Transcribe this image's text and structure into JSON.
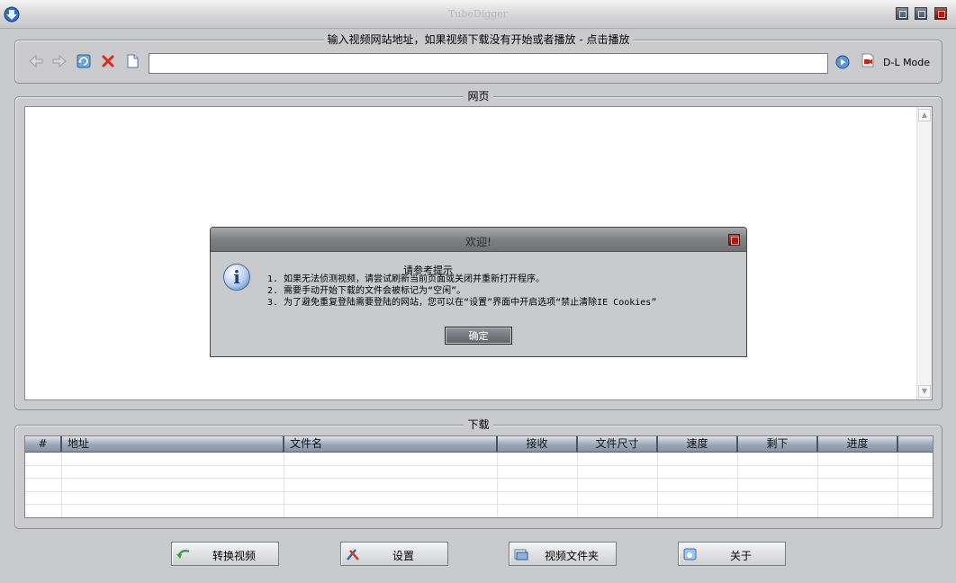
{
  "window": {
    "title": "TubeDigger"
  },
  "url_bar": {
    "caption": "输入视频网站地址，如果视频下载没有开始或者播放 - 点击播放",
    "url_value": "",
    "dl_mode_label": "D-L Mode",
    "icons": [
      "back-icon",
      "forward-icon",
      "refresh-icon",
      "stop-icon",
      "page-icon",
      "play-icon",
      "record-icon"
    ]
  },
  "webpage": {
    "caption": "网页"
  },
  "dialog": {
    "title": "欢迎!",
    "heading": "请参考提示",
    "lines": [
      "1. 如果无法侦测视频，请尝试刷新当前页面或关闭并重新打开程序。",
      "2. 需要手动开始下载的文件会被标记为“空闲”。",
      "3. 为了避免重复登陆需要登陆的网站，您可以在“设置”界面中开启选项“禁止清除IE Cookies”"
    ],
    "ok_label": "确定"
  },
  "downloads": {
    "caption": "下载",
    "columns": [
      "#",
      "地址",
      "文件名",
      "接收",
      "文件尺寸",
      "速度",
      "剩下",
      "进度",
      ""
    ],
    "rows": [
      [],
      [],
      [],
      [],
      []
    ]
  },
  "buttons": {
    "convert": "转换视频",
    "settings": "设置",
    "video_folder": "视频文件夹",
    "about": "关于"
  },
  "colors": {
    "window_bg": "#c9cacd",
    "header_blue": "#8593a3",
    "close_red": "#a51f16"
  }
}
